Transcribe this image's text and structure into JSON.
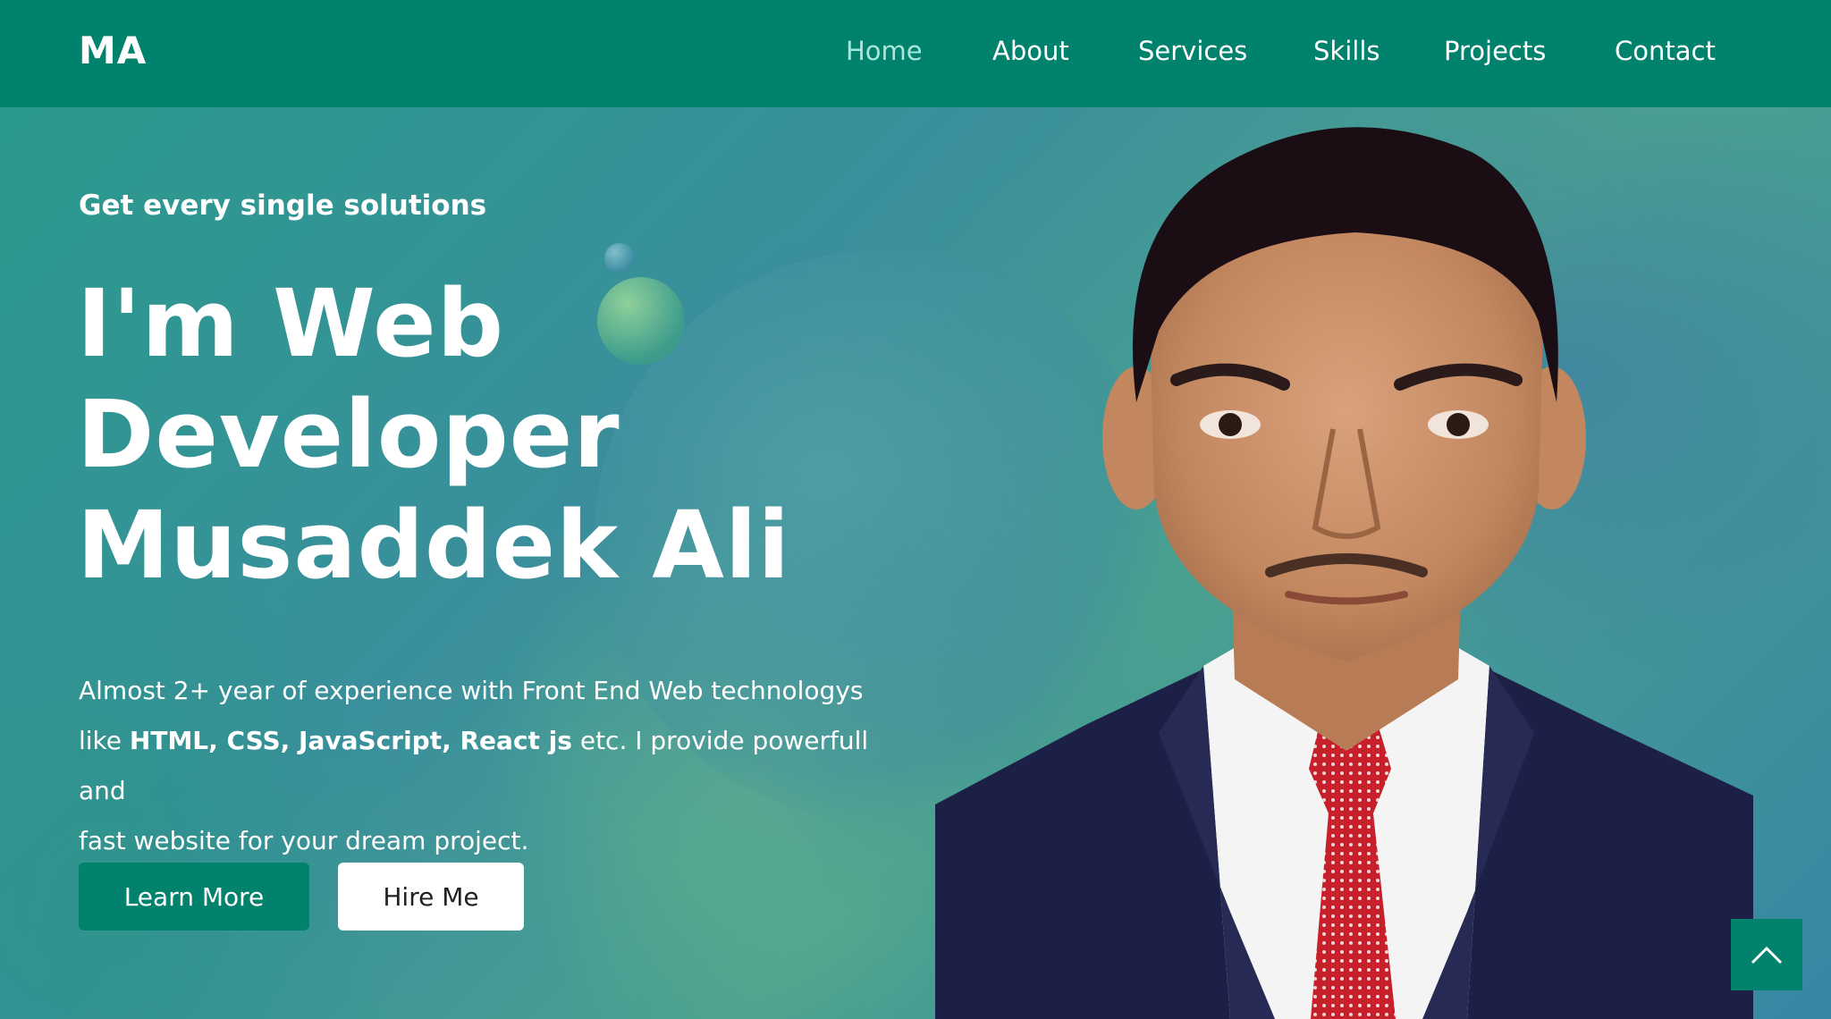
{
  "nav": {
    "logo": "MA",
    "links": [
      "Home",
      "About",
      "Services",
      "Skills",
      "Projects",
      "Contact"
    ],
    "active": "Home"
  },
  "hero": {
    "tagline": "Get every single solutions",
    "headline_line1": "I'm Web",
    "headline_line2": "Developer",
    "headline_line3": "Musaddek Ali",
    "desc_part1": "Almost 2+ year of experience with Front End Web technologys",
    "desc_like": "like ",
    "desc_tech": "HTML, CSS, JavaScript, React js",
    "desc_part2": " etc. I provide powerfull and",
    "desc_part3": "fast website for your dream project.",
    "learn_more_label": "Learn More",
    "hire_me_label": "Hire Me"
  },
  "colors": {
    "brand": "#00826c",
    "active_link": "#a8e6da"
  },
  "icons": {
    "scroll_top": "chevron-up-icon"
  }
}
